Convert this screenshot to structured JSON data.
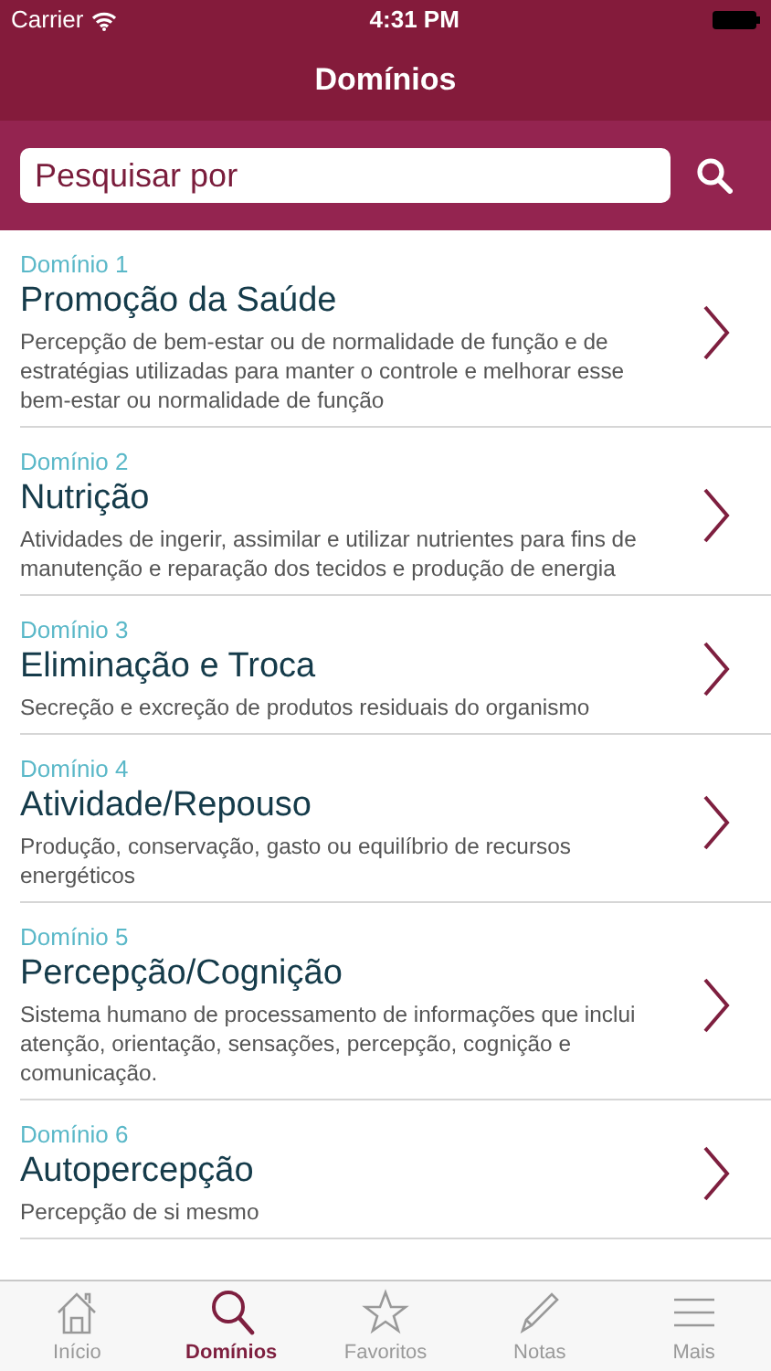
{
  "status_bar": {
    "carrier": "Carrier",
    "time": "4:31 PM"
  },
  "nav": {
    "title": "Domínios"
  },
  "search": {
    "placeholder": "Pesquisar por"
  },
  "domains": [
    {
      "label": "Domínio 1",
      "title": "Promoção da Saúde",
      "description": "Percepção de bem-estar ou de normalidade de função e de estratégias utilizadas para manter o controle e melhorar esse bem-estar ou normalidade de função"
    },
    {
      "label": "Domínio 2",
      "title": "Nutrição",
      "description": "Atividades de ingerir, assimilar e utilizar nutrientes para fins de manutenção e reparação dos tecidos e produção de energia"
    },
    {
      "label": "Domínio 3",
      "title": "Eliminação e Troca",
      "description": "Secreção e excreção de produtos residuais do organismo"
    },
    {
      "label": "Domínio 4",
      "title": "Atividade/Repouso",
      "description": "Produção, conservação, gasto ou equilíbrio de recursos energéticos"
    },
    {
      "label": "Domínio 5",
      "title": "Percepção/Cognição",
      "description": "Sistema humano de processamento de informações que inclui atenção, orientação, sensações, percepção, cognição e comunicação."
    },
    {
      "label": "Domínio 6",
      "title": "Autopercepção",
      "description": "Percepção de si mesmo"
    }
  ],
  "tab_bar": [
    {
      "label": "Início",
      "selected": false
    },
    {
      "label": "Domínios",
      "selected": true
    },
    {
      "label": "Favoritos",
      "selected": false
    },
    {
      "label": "Notas",
      "selected": false
    },
    {
      "label": "Mais",
      "selected": false
    }
  ]
}
